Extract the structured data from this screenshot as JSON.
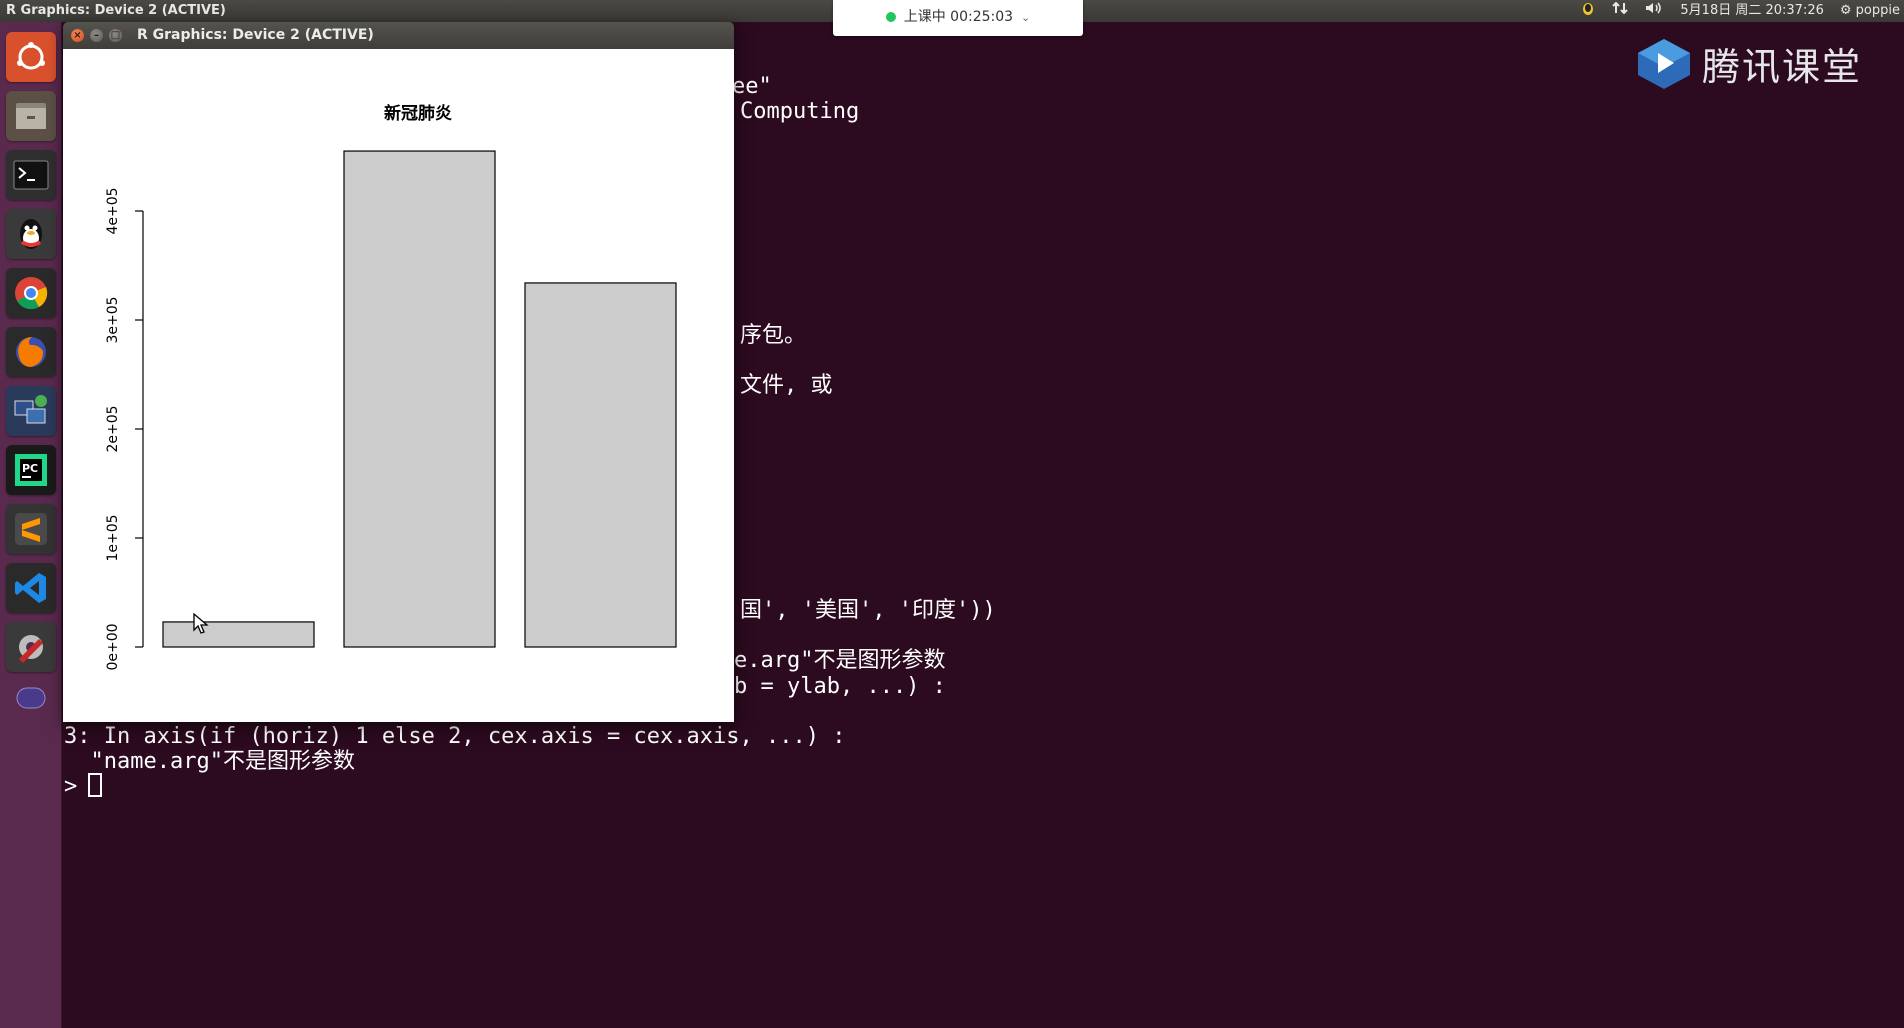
{
  "top_panel": {
    "window_title": "R Graphics: Device 2 (ACTIVE)",
    "datetime": "5月18日 周二 20:37:26",
    "user": "poppie"
  },
  "classroom": {
    "status": "上课中 00:25:03"
  },
  "logo": {
    "text": "腾讯课堂"
  },
  "launcher": {
    "items": [
      {
        "name": "dash-home-icon",
        "color": "#e0613a"
      },
      {
        "name": "files-icon",
        "color": "#d9d2c2"
      },
      {
        "name": "terminal-icon",
        "color": "#2f2f2f"
      },
      {
        "name": "qq-icon",
        "color": "#f0f0f0"
      },
      {
        "name": "chrome-icon",
        "color": "#4285f4"
      },
      {
        "name": "firefox-icon",
        "color": "#f57c00"
      },
      {
        "name": "remote-desktop-icon",
        "color": "#3a6fb0"
      },
      {
        "name": "pycharm-icon",
        "color": "#21d789"
      },
      {
        "name": "sublime-text-icon",
        "color": "#ff9800"
      },
      {
        "name": "vscode-icon",
        "color": "#1e88e5"
      },
      {
        "name": "system-settings-icon",
        "color": "#c62828"
      },
      {
        "name": "workspace-switcher-icon",
        "color": "#7a4a9a"
      }
    ]
  },
  "terminal": {
    "lines": [
      "ee\"",
      "Computing",
      "序包。",
      "文件, 或",
      "国', '美国', '印度'))",
      "e.arg\"不是图形参数",
      "b = ylab, ...) :",
      "3: In axis(if (horiz) 1 else 2, cex.axis = cex.axis, ...) :",
      "  \"name.arg\"不是图形参数",
      ">"
    ]
  },
  "rwindow": {
    "title": "R Graphics: Device 2 (ACTIVE)",
    "close_glyph": "×",
    "min_glyph": "–",
    "max_glyph": "□"
  },
  "chart_data": {
    "type": "bar",
    "title": "新冠肺炎",
    "categories": [
      "",
      "",
      ""
    ],
    "values": [
      23000,
      455000,
      334000
    ],
    "xlabel": "",
    "ylabel": "",
    "ylim": [
      0,
      400000
    ],
    "yticks": [
      0,
      100000,
      200000,
      300000,
      400000
    ],
    "ytick_labels": [
      "0e+00",
      "1e+05",
      "2e+05",
      "3e+05",
      "4e+05"
    ],
    "bar_color": "#cccccc",
    "grid": false
  }
}
